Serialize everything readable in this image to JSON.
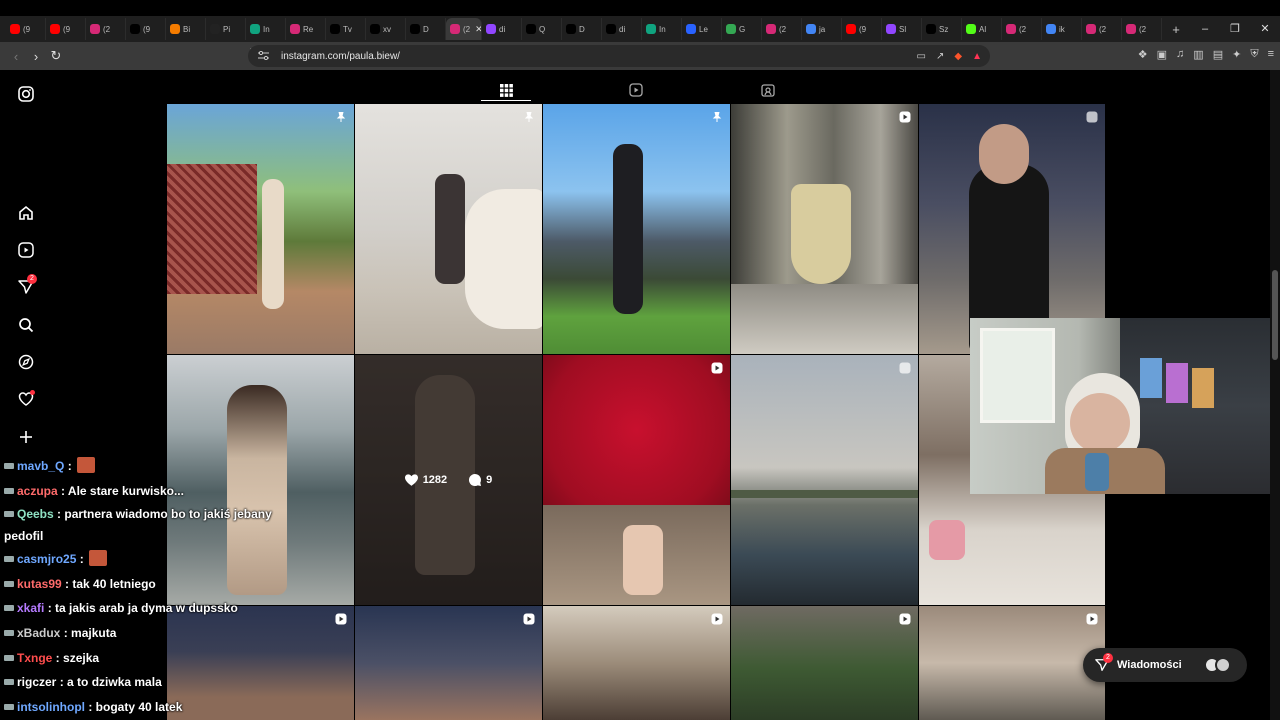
{
  "browser": {
    "tabs": [
      {
        "label": "(9",
        "fav": "youtube-icon",
        "color": "#ff0000"
      },
      {
        "label": "(9",
        "fav": "youtube-icon",
        "color": "#ff0000"
      },
      {
        "label": "(2",
        "fav": "instagram-icon",
        "color": "#d62976"
      },
      {
        "label": "(9",
        "fav": "tiktok-icon",
        "color": "#000000"
      },
      {
        "label": "Bi",
        "fav": "orange-icon",
        "color": "#f57c00"
      },
      {
        "label": "Pi",
        "fav": "b-icon",
        "color": "#222222"
      },
      {
        "label": "In",
        "fav": "chat-icon",
        "color": "#10a37f"
      },
      {
        "label": "Re",
        "fav": "instagram-icon",
        "color": "#d62976"
      },
      {
        "label": "Tv",
        "fav": "x-icon",
        "color": "#000000"
      },
      {
        "label": "xv",
        "fav": "x-icon",
        "color": "#000000"
      },
      {
        "label": "D",
        "fav": "x-icon",
        "color": "#000000"
      },
      {
        "label": "(2",
        "fav": "instagram-icon",
        "color": "#d62976"
      },
      {
        "label": "di",
        "fav": "twitch-icon",
        "color": "#9146ff"
      },
      {
        "label": "Q",
        "fav": "x-icon",
        "color": "#000000"
      },
      {
        "label": "D",
        "fav": "tiktok-icon",
        "color": "#000000"
      },
      {
        "label": "di",
        "fav": "x-icon",
        "color": "#000000"
      },
      {
        "label": "In",
        "fav": "chat-icon",
        "color": "#10a37f"
      },
      {
        "label": "Le",
        "fav": "pin-icon",
        "color": "#2962ff"
      },
      {
        "label": "G",
        "fav": "maps-icon",
        "color": "#34a853"
      },
      {
        "label": "(2",
        "fav": "instagram-icon",
        "color": "#d62976"
      },
      {
        "label": "ja",
        "fav": "google-icon",
        "color": "#4285f4"
      },
      {
        "label": "(9",
        "fav": "youtube-icon",
        "color": "#ff0000"
      },
      {
        "label": "Sl",
        "fav": "twitch-icon",
        "color": "#9146ff"
      },
      {
        "label": "Sz",
        "fav": "x-icon",
        "color": "#000000"
      },
      {
        "label": "Al",
        "fav": "k-icon",
        "color": "#53fc18"
      },
      {
        "label": "(2",
        "fav": "instagram-icon",
        "color": "#d62976"
      },
      {
        "label": "ik",
        "fav": "google-icon",
        "color": "#4285f4"
      },
      {
        "label": "(2",
        "fav": "instagram-icon",
        "color": "#d62976"
      },
      {
        "label": "(2",
        "fav": "instagram-icon",
        "color": "#d62976"
      }
    ],
    "active_tab_index": 11,
    "new_tab": "+",
    "window_controls": [
      "–",
      "❐",
      "✕"
    ],
    "url": "instagram.com/paula.biew/"
  },
  "instagram": {
    "notif_badge": "2",
    "hover_likes": "1282",
    "hover_comments": "9"
  },
  "chat": [
    {
      "user": "mavb_Q",
      "sep": " :",
      "msg": "",
      "color": "#6fa8ff",
      "emote": true
    },
    {
      "user": "aczupa",
      "sep": " :",
      "msg": " Ale stare kurwisko...",
      "color": "#ff6b6b"
    },
    {
      "user": "Qeebs",
      "sep": " :",
      "msg": " partnera wiadomo bo to jakiś jebany pedofil",
      "color": "#8ee0c2",
      "wrap": true
    },
    {
      "user": "casmjro25",
      "sep": " :",
      "msg": "",
      "color": "#6fa8ff",
      "emote": true
    },
    {
      "user": "kutas99",
      "sep": " :",
      "msg": " tak 40 letniego",
      "color": "#ff6b6b"
    },
    {
      "user": "xkafi",
      "sep": " :",
      "msg": " ta jakis arab ja dyma w dupssko",
      "color": "#b57bff"
    },
    {
      "user": "xBadux",
      "sep": " :",
      "msg": " majkuta",
      "color": "#cccccc"
    },
    {
      "user": "Txnge",
      "sep": " :",
      "msg": " szejka",
      "color": "#ff4d4d"
    },
    {
      "user": "rigczer",
      "sep": " :",
      "msg": " a to dziwka mala",
      "color": "#ffffff"
    },
    {
      "user": "intsolinhopl",
      "sep": " :",
      "msg": " bogaty 40 latek",
      "color": "#6fa8ff"
    }
  ],
  "messages_pill": {
    "label": "Wiadomości",
    "badge": "2"
  }
}
